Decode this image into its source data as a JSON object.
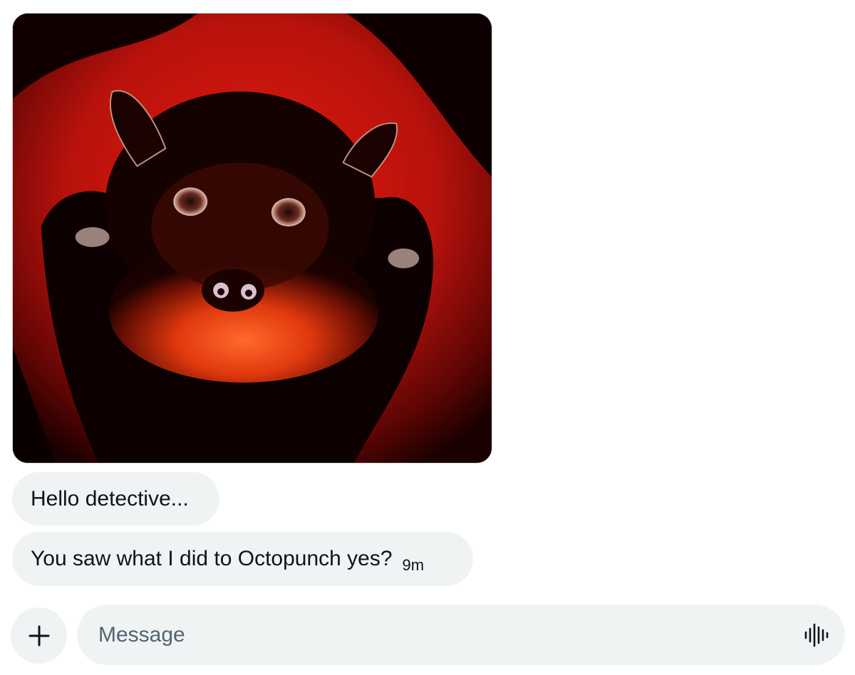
{
  "messages": [
    {
      "type": "image",
      "alt": ""
    },
    {
      "type": "text",
      "text": "Hello detective..."
    },
    {
      "type": "text",
      "text": "You saw what I did to Octopunch yes?",
      "time": "9m"
    }
  ],
  "composer": {
    "placeholder": "Message",
    "add_icon": "plus-icon",
    "voice_icon": "audio-waveform-icon"
  },
  "colors": {
    "bubble_bg": "#eff3f4",
    "text": "#0f1419",
    "placeholder": "#536471",
    "image_red": "#c8140e"
  }
}
